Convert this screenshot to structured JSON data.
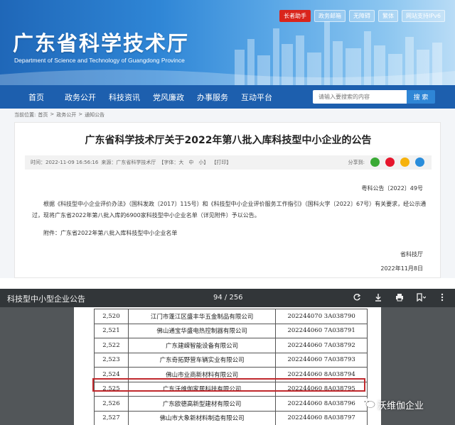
{
  "site": {
    "title": "广东省科学技术厅",
    "subtitle": "Department of Science and Technology of Guangdong Province",
    "toplinks": [
      "长者助手",
      "政务邮箱",
      "无障碍",
      "繁体",
      "网站支持IPv6"
    ],
    "nav": [
      "首页",
      "政务公开",
      "科技资讯",
      "党风廉政",
      "办事服务",
      "互动平台"
    ],
    "search": {
      "placeholder": "请输入要搜索的内容",
      "button": "搜 索"
    },
    "breadcrumb": [
      "当前位置:",
      "首页",
      ">",
      "政务公开",
      ">",
      "通知公告"
    ]
  },
  "notice": {
    "title": "广东省科学技术厅关于2022年第八批入库科技型中小企业的公告",
    "time": "时间：2022-11-09 16:56:16",
    "source": "来源：广东省科学技术厅",
    "font_label": "【字体：大　中　小】",
    "print_label": "【打印】",
    "share_label": "分享到:",
    "doc_no": "粤科公告〔2022〕49号",
    "paragraph": "根据《科技型中小企业评价办法》（国科发政〔2017〕115号）和《科技型中小企业评价服务工作指引》（国科火字〔2022〕67号）有关要求，经公示通过，现将广东省2022年第八批入库的6900家科技型中小企业名单（详见附件）予以公告。",
    "attachment": "附件：广东省2022年第八批入库科技型中小企业名单",
    "sign_org": "省科技厅",
    "sign_date": "2022年11月8日"
  },
  "viewer": {
    "title": "科技型中小型企业公告",
    "page_indicator": "94 / 256",
    "rows": [
      {
        "no": "2,520",
        "name": "江门市蓬江区盛丰华五金制品有限公司",
        "code": "202244070 3A038790"
      },
      {
        "no": "2,521",
        "name": "佛山通宝华盛电热控制器有限公司",
        "code": "202244060 7A038791"
      },
      {
        "no": "2,522",
        "name": "广东建嵘智能设备有限公司",
        "code": "202244060 7A038792"
      },
      {
        "no": "2,523",
        "name": "广东奇拓野营车辆实业有限公司",
        "code": "202244060 7A038793"
      },
      {
        "no": "2,524",
        "name": "佛山市业商新材料有限公司",
        "code": "202244060 8A038794"
      },
      {
        "no": "2,525",
        "name": "广东沃维伽家居科技有限公司",
        "code": "202244060 8A038795"
      },
      {
        "no": "2,526",
        "name": "广东欧德高新型建材有限公司",
        "code": "202244060 8A038796"
      },
      {
        "no": "2,527",
        "name": "佛山市大象新材料制造有限公司",
        "code": "202244060 8A038797"
      }
    ]
  },
  "watermark": "沃维伽企业",
  "colors": {
    "nav": "#1d5fae",
    "highlight": "#c0282c",
    "viewer_bar": "#323639"
  }
}
